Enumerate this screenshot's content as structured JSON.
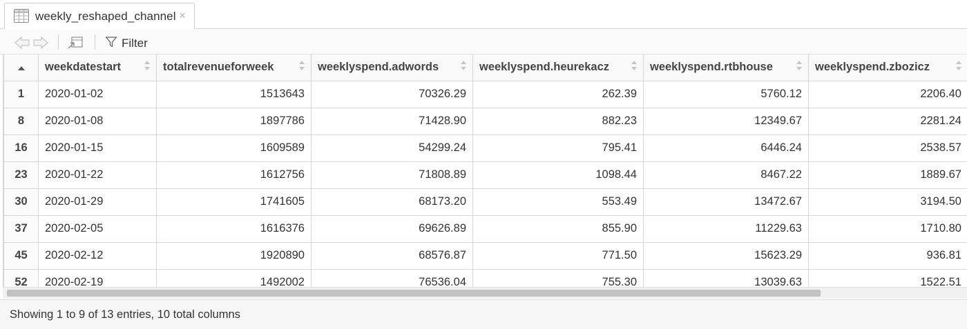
{
  "tab": {
    "title": "weekly_reshaped_channel",
    "close_label": "×"
  },
  "toolbar": {
    "filter_label": "Filter"
  },
  "table": {
    "columns": [
      "",
      "weekdatestart",
      "totalrevenueforweek",
      "weeklyspend.adwords",
      "weeklyspend.heurekacz",
      "weeklyspend.rtbhouse",
      "weeklyspend.zbozicz"
    ],
    "rows": [
      [
        "1",
        "2020-01-02",
        "1513643",
        "70326.29",
        "262.39",
        "5760.12",
        "2206.40"
      ],
      [
        "8",
        "2020-01-08",
        "1897786",
        "71428.90",
        "882.23",
        "12349.67",
        "2281.24"
      ],
      [
        "16",
        "2020-01-15",
        "1609589",
        "54299.24",
        "795.41",
        "6446.24",
        "2538.57"
      ],
      [
        "23",
        "2020-01-22",
        "1612756",
        "71808.89",
        "1098.44",
        "8467.22",
        "1889.67"
      ],
      [
        "30",
        "2020-01-29",
        "1741605",
        "68173.20",
        "553.49",
        "13472.67",
        "3194.50"
      ],
      [
        "37",
        "2020-02-05",
        "1616376",
        "69626.89",
        "855.90",
        "11229.63",
        "1710.80"
      ],
      [
        "45",
        "2020-02-12",
        "1920890",
        "68576.87",
        "771.50",
        "15623.29",
        "936.81"
      ],
      [
        "52",
        "2020-02-19",
        "1492002",
        "76536.04",
        "755.30",
        "13039.63",
        "1522.51"
      ]
    ]
  },
  "footer": {
    "status": "Showing 1 to 9 of 13 entries, 10 total columns"
  },
  "colors": {
    "border": "#d6d6d6",
    "header_bg": "#f9f9f9",
    "footer_bg": "#f7f7f7",
    "scroll_thumb": "#c2c2c2"
  }
}
